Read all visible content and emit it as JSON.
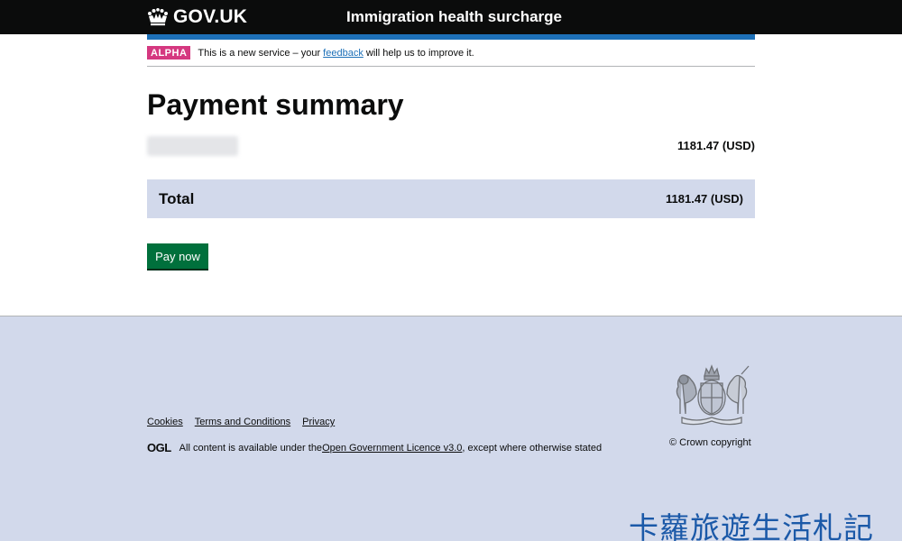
{
  "header": {
    "logo_text": "GOV.UK",
    "service_name": "Immigration health surcharge"
  },
  "phase_banner": {
    "tag": "ALPHA",
    "text_before": "This is a new service – your ",
    "link_text": "feedback",
    "text_after": " will help us to improve it."
  },
  "main": {
    "heading": "Payment summary",
    "item": {
      "reference": "",
      "amount": "1181.47 (USD)"
    },
    "total": {
      "label": "Total",
      "amount": "1181.47 (USD)"
    },
    "pay_button_label": "Pay now"
  },
  "footer": {
    "links": [
      "Cookies",
      "Terms and Conditions",
      "Privacy"
    ],
    "ogl_logo": "OGL",
    "licence_before": "All content is available under the ",
    "licence_link": "Open Government Licence v3.0",
    "licence_after": ", except where otherwise stated",
    "crown_copyright": "© Crown copyright"
  },
  "watermark": "卡蘿旅遊生活札記",
  "colors": {
    "header_bg": "#0b0c0c",
    "accent_blue": "#1d70b8",
    "alpha_tag": "#d53880",
    "pay_button": "#00703c",
    "footer_bg": "#d2d9eb"
  }
}
